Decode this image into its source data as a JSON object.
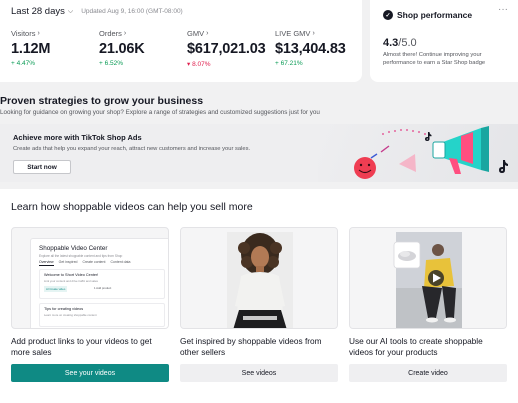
{
  "header": {
    "date_range": "Last 28 days",
    "updated": "Updated Aug 9, 16:00 (GMT-08:00)"
  },
  "metrics": [
    {
      "label": "Visitors",
      "value": "1.12M",
      "delta": "+ 4.47%",
      "trend": "up"
    },
    {
      "label": "Orders",
      "value": "21.06K",
      "delta": "+ 6.52%",
      "trend": "up"
    },
    {
      "label": "GMV",
      "value": "$617,021.03",
      "delta": "▾ 8.07%",
      "trend": "down"
    },
    {
      "label": "LIVE GMV",
      "value": "$13,404.83",
      "delta": "+ 67.21%",
      "trend": "up"
    }
  ],
  "shop_performance": {
    "title": "Shop performance",
    "score": "4.3",
    "score_max": "/5.0",
    "description": "Almost there! Continue improving your performance to earn a Star Shop badge"
  },
  "strategies": {
    "title": "Proven strategies to grow your business",
    "subtitle": "Looking for guidance on growing your shop? Explore a range of strategies and customized suggestions just for you"
  },
  "ads_banner": {
    "title": "Achieve more with TikTok Shop Ads",
    "description": "Create ads that help you expand your reach, attract new customers and increase your sales.",
    "button": "Start now"
  },
  "learn": {
    "title": "Learn how shoppable videos can help you sell more",
    "cards": [
      {
        "text": "Add product links to your videos to get more sales",
        "button": "See your videos",
        "mock": {
          "title": "Shoppable Video Center",
          "subtitle": "Explore all the latest shoppable content and tips from Shop",
          "tabs": [
            "Overview",
            "Get inspired",
            "Create content",
            "Content data"
          ],
          "box_title": "Welcome to Short Video Center!",
          "box_line": "Link your content and drive traffic and sales",
          "chip": "AI Create video",
          "chip2": "1 Add product",
          "box2_title": "Tips for creating videos",
          "box2_line": "Learn more on creating shoppable content"
        }
      },
      {
        "text": "Get inspired by shoppable videos from other sellers",
        "button": "See videos"
      },
      {
        "text": "Use our AI tools to create shoppable videos for your products",
        "button": "Create video"
      }
    ]
  },
  "colors": {
    "teal": "#0f8a84",
    "positive": "#0a9b55",
    "negative": "#e0204f",
    "tiktok_pink": "#fe2c55",
    "tiktok_cyan": "#25f4ee"
  }
}
